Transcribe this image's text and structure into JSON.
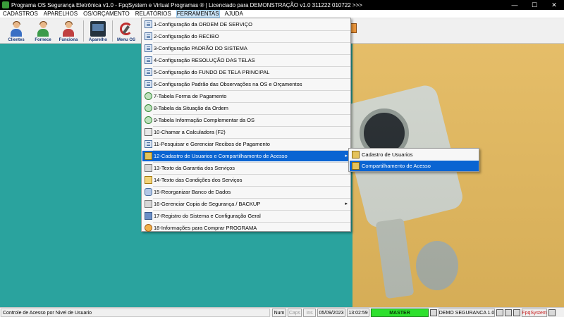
{
  "titlebar": {
    "title": "Programa OS Segurança Eletrônica v1.0 - FpqSystem e Virtual Programas ® | Licenciado para  DEMONSTRAÇÃO v1.0 311222 010722 >>>",
    "minimize": "—",
    "maximize": "☐",
    "close": "✕"
  },
  "menubar": {
    "items": [
      "CADASTROS",
      "APARELHOS",
      "OS/ORÇAMENTO",
      "RELATÓRIOS",
      "FERRAMENTAS",
      "AJUDA"
    ]
  },
  "toolbar": {
    "buttons": [
      {
        "label": "Clientes",
        "icon": "clients-icon"
      },
      {
        "label": "Fornece",
        "icon": "suppliers-icon"
      },
      {
        "label": "Funciona",
        "icon": "employees-icon"
      },
      {
        "label": "Aparelho",
        "icon": "device-icon"
      },
      {
        "label": "Menu OS",
        "icon": "menu-os-icon"
      }
    ]
  },
  "ferramentas_menu": {
    "items": [
      {
        "label": "1-Configuração da ORDEM DE SERVIÇO",
        "icon": "doc-icon"
      },
      {
        "label": "2-Configuração do RECIBO",
        "icon": "doc-icon"
      },
      {
        "label": "3-Configuração PADRÃO DO SISTEMA",
        "icon": "doc-icon"
      },
      {
        "label": "4-Configuração RESOLUÇÃO DAS TELAS",
        "icon": "doc-icon"
      },
      {
        "label": "5-Configuração do FUNDO DE TELA PRINCIPAL",
        "icon": "doc-icon"
      },
      {
        "label": "6-Configuração Padrão das Observações na OS e Orçamentos",
        "icon": "doc-icon"
      },
      {
        "label": "7-Tabela Forma de Pagamento",
        "icon": "globe-icon"
      },
      {
        "label": "8-Tabela da Situação da Ordem",
        "icon": "globe-icon"
      },
      {
        "label": "9-Tabela Informação Complementar da OS",
        "icon": "globe-icon"
      },
      {
        "label": "10-Chamar a Calculadora (F2)",
        "icon": "calculator-icon"
      },
      {
        "label": "11-Pesquisar e Gerenciar Recibos de Pagamento",
        "icon": "doc-icon"
      },
      {
        "label": "12-Cadastro de Usuarios e Compartilhamento de Acesso",
        "icon": "users-icon",
        "selected": true,
        "has_submenu": true
      },
      {
        "label": "13-Texto da Garantia dos Serviços",
        "icon": "tools-icon"
      },
      {
        "label": "14-Texto das Condições dos Serviços",
        "icon": "warning-icon"
      },
      {
        "label": "15-Reorganizar Banco de Dados",
        "icon": "database-icon"
      },
      {
        "label": "16-Gerenciar Copia de Segurança / BACKUP",
        "icon": "tools-icon",
        "has_submenu": true
      },
      {
        "label": "17-Registro do Sistema e Configuração Geral",
        "icon": "save-icon"
      },
      {
        "label": "18-Informações para Comprar PROGRAMA",
        "icon": "cart-icon"
      }
    ],
    "submenu_arrow": "▸"
  },
  "submenu": {
    "items": [
      {
        "label": "Cadastro de Usuarios",
        "icon": "users-icon"
      },
      {
        "label": "Compartilhamento de Acesso",
        "icon": "users-icon",
        "selected": true
      }
    ]
  },
  "statusbar": {
    "message": "Controle de Acesso por Nivel de Usuario",
    "num": "Num",
    "caps": "Caps",
    "ins": "Ins",
    "date": "05/09/2023",
    "time": "13:02:59",
    "user": "MASTER",
    "edition": "DEMO SEGURANCA 1.0",
    "brand": "FpqSystem"
  },
  "colors": {
    "selection": "#0a64d2",
    "desktop_teal": "#2aa39e",
    "wall": "#e3b85c",
    "master_bg": "#2ee02e",
    "brand_red": "#c81e1e"
  }
}
